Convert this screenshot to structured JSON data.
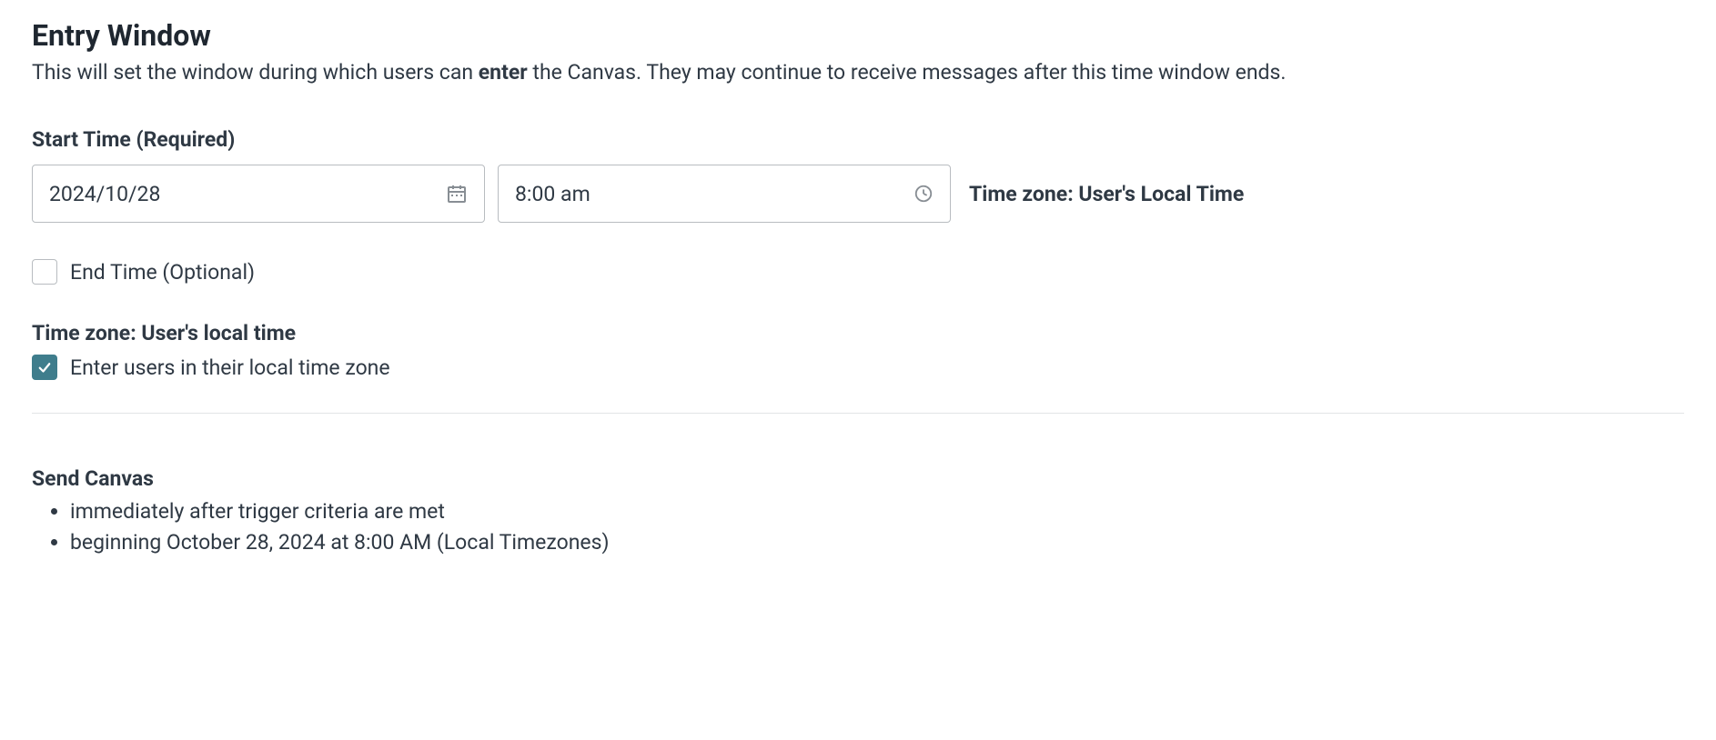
{
  "entryWindow": {
    "title": "Entry Window",
    "descriptionPrefix": "This will set the window during which users can ",
    "descriptionBold": "enter",
    "descriptionSuffix": " the Canvas. They may continue to receive messages after this time window ends."
  },
  "startTime": {
    "label": "Start Time (Required)",
    "dateValue": "2024/10/28",
    "timeValue": "8:00 am",
    "timezoneLabel": "Time zone: User's Local Time"
  },
  "endTime": {
    "label": "End Time (Optional)",
    "checked": false
  },
  "timezone": {
    "sectionLabel": "Time zone: User's local time",
    "checkboxLabel": "Enter users in their local time zone",
    "checked": true
  },
  "sendCanvas": {
    "title": "Send Canvas",
    "items": [
      "immediately after trigger criteria are met",
      "beginning October 28, 2024 at 8:00 AM (Local Timezones)"
    ]
  }
}
